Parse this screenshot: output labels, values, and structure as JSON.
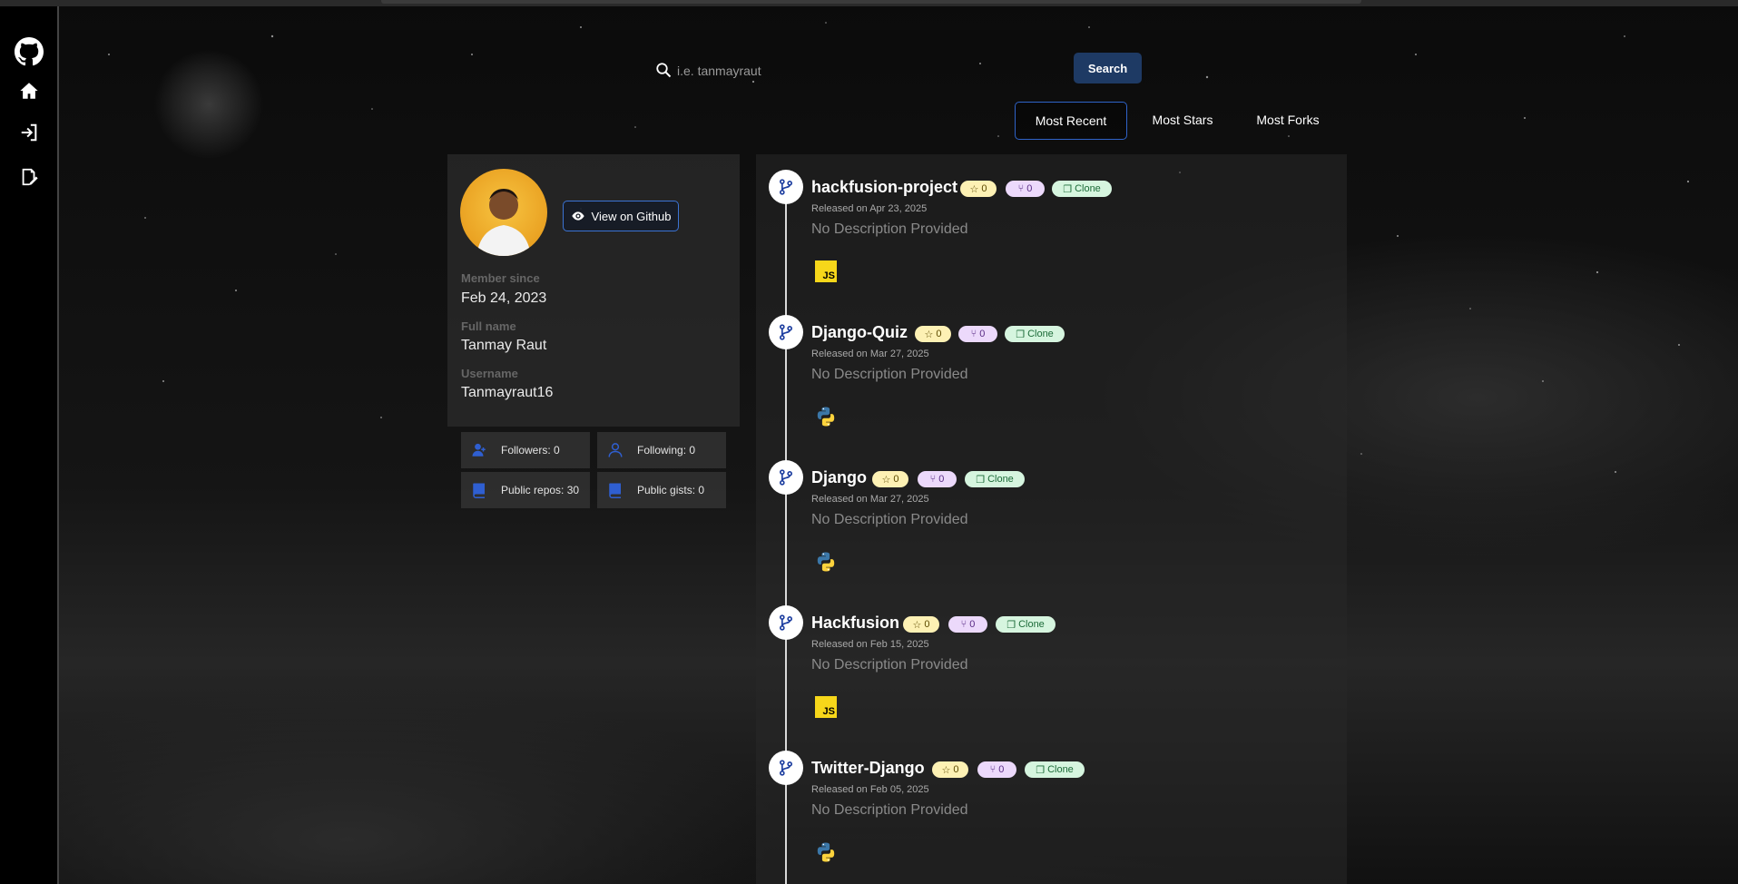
{
  "search": {
    "placeholder": "i.e. tanmayraut",
    "value": "",
    "button_label": "Search"
  },
  "sort_tabs": [
    {
      "label": "Most Recent",
      "active": true
    },
    {
      "label": "Most Stars",
      "active": false
    },
    {
      "label": "Most Forks",
      "active": false
    }
  ],
  "sidebar": {
    "items": [
      {
        "icon": "github-icon"
      },
      {
        "icon": "home-icon"
      },
      {
        "icon": "login-icon"
      },
      {
        "icon": "signup-icon"
      }
    ]
  },
  "profile": {
    "view_github_label": "View on Github",
    "fields": [
      {
        "label": "Member since",
        "value": "Feb 24, 2023"
      },
      {
        "label": "Full name",
        "value": "Tanmay Raut"
      },
      {
        "label": "Username",
        "value": "Tanmayraut16"
      }
    ],
    "stats": [
      {
        "label": "Followers: 0",
        "icon": "followers-icon"
      },
      {
        "label": "Following: 0",
        "icon": "following-icon"
      },
      {
        "label": "Public repos: 30",
        "icon": "repos-icon"
      },
      {
        "label": "Public gists: 0",
        "icon": "gists-icon"
      }
    ]
  },
  "repos": [
    {
      "name": "hackfusion-project",
      "stars": "0",
      "forks": "0",
      "clone_label": "Clone",
      "released": "Released on Apr 23, 2025",
      "description": "No Description Provided",
      "language": "javascript"
    },
    {
      "name": "Django-Quiz",
      "stars": "0",
      "forks": "0",
      "clone_label": "Clone",
      "released": "Released on Mar 27, 2025",
      "description": "No Description Provided",
      "language": "python"
    },
    {
      "name": "Django",
      "stars": "0",
      "forks": "0",
      "clone_label": "Clone",
      "released": "Released on Mar 27, 2025",
      "description": "No Description Provided",
      "language": "python"
    },
    {
      "name": "Hackfusion",
      "stars": "0",
      "forks": "0",
      "clone_label": "Clone",
      "released": "Released on Feb 15, 2025",
      "description": "No Description Provided",
      "language": "javascript"
    },
    {
      "name": "Twitter-Django",
      "stars": "0",
      "forks": "0",
      "clone_label": "Clone",
      "released": "Released on Feb 05, 2025",
      "description": "No Description Provided",
      "language": "python"
    }
  ],
  "js_logo_text": "JS",
  "colors": {
    "accent_blue": "#1e3a64",
    "active_border": "#2f63c8",
    "star_badge": "#fdf1b4",
    "fork_badge": "#ecd9fb",
    "clone_badge": "#d6f5df"
  }
}
